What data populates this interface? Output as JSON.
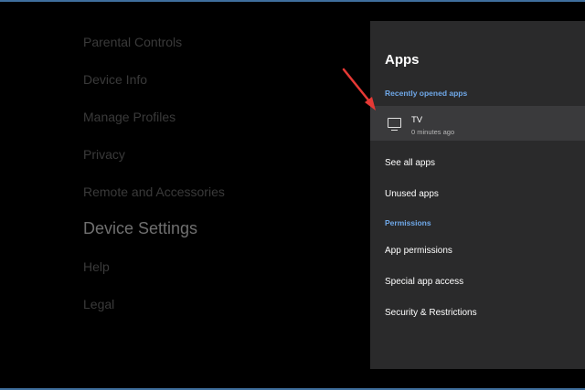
{
  "left_menu": {
    "items": [
      {
        "label": "Parental Controls"
      },
      {
        "label": "Device Info"
      },
      {
        "label": "Manage Profiles"
      },
      {
        "label": "Privacy"
      },
      {
        "label": "Remote and Accessories"
      },
      {
        "label": "Device Settings"
      },
      {
        "label": "Help"
      },
      {
        "label": "Legal"
      }
    ],
    "active_index": 5
  },
  "apps_panel": {
    "title": "Apps",
    "recently_opened_header": "Recently opened apps",
    "recent_app": {
      "name": "TV",
      "subtitle": "0 minutes ago",
      "icon": "tv-icon"
    },
    "see_all": "See all apps",
    "unused": "Unused apps",
    "permissions_header": "Permissions",
    "app_permissions": "App permissions",
    "special_access": "Special app access",
    "security": "Security & Restrictions"
  },
  "colors": {
    "background": "#000000",
    "panel": "#2a2a2b",
    "selected_row": "#3a3a3c",
    "section_header": "#6fa8e8",
    "annotation_arrow": "#e53935"
  }
}
